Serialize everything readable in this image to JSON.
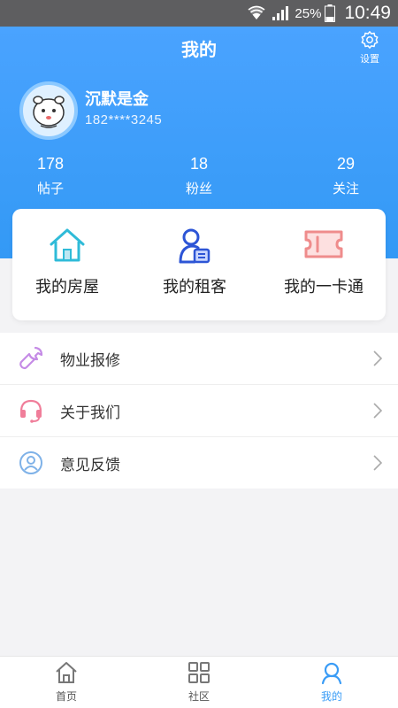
{
  "status_bar": {
    "battery": "25%",
    "time": "10:49"
  },
  "header": {
    "title": "我的",
    "settings_label": "设置"
  },
  "profile": {
    "name": "沉默是金",
    "phone": "182****3245"
  },
  "stats": [
    {
      "value": "178",
      "label": "帖子"
    },
    {
      "value": "18",
      "label": "粉丝"
    },
    {
      "value": "29",
      "label": "关注"
    }
  ],
  "quick_links": [
    {
      "label": "我的房屋",
      "icon": "house-icon"
    },
    {
      "label": "我的租客",
      "icon": "tenant-icon"
    },
    {
      "label": "我的一卡通",
      "icon": "card-icon"
    }
  ],
  "menu": [
    {
      "label": "物业报修",
      "icon": "wrench-icon"
    },
    {
      "label": "关于我们",
      "icon": "headset-icon"
    },
    {
      "label": "意见反馈",
      "icon": "user-circle-icon"
    }
  ],
  "tabs": [
    {
      "label": "首页",
      "icon": "home-icon"
    },
    {
      "label": "社区",
      "icon": "grid-icon"
    },
    {
      "label": "我的",
      "icon": "person-icon",
      "active": true
    }
  ],
  "colors": {
    "primary": "#3a9cf6",
    "header_bg": "#3d9ef8"
  }
}
